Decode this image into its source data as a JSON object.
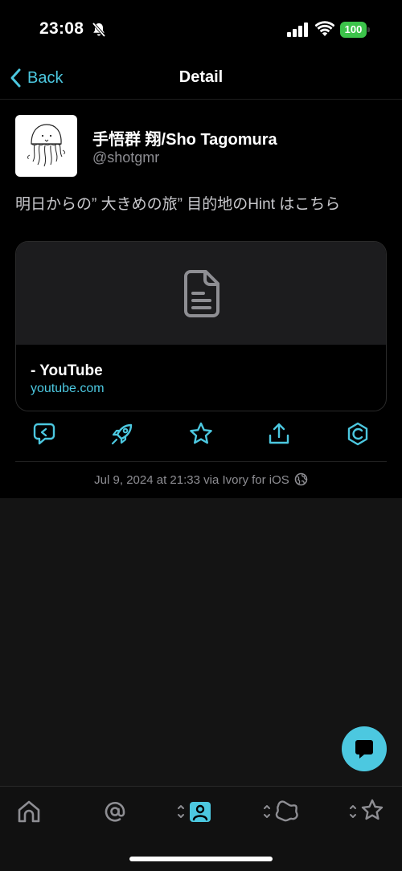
{
  "status_bar": {
    "time": "23:08",
    "battery": "100",
    "icons": [
      "bell-slash-icon",
      "signal-icon",
      "wifi-icon",
      "battery-icon"
    ]
  },
  "nav": {
    "back_label": "Back",
    "title": "Detail"
  },
  "post": {
    "display_name": "手悟群 翔/Sho Tagomura",
    "handle": "@shotgmr",
    "text": "明日からの” 大きめの旅” 目的地のHint はこちら",
    "link_card": {
      "title": "- YouTube",
      "domain": "youtube.com",
      "icon": "document-icon"
    },
    "meta": "Jul 9, 2024 at 21:33 via Ivory for iOS",
    "visibility_icon": "globe-icon",
    "actions": [
      "reply-icon",
      "boost-icon",
      "favorite-icon",
      "share-icon",
      "more-icon"
    ]
  },
  "compose_button": {
    "icon": "compose-bubble-icon"
  },
  "tab_bar": {
    "tabs": [
      "home-icon",
      "mentions-icon",
      "profile-icon",
      "lists-icon",
      "favorites-icon"
    ]
  },
  "colors": {
    "accent": "#4cc8e0",
    "background": "#000000",
    "secondary_text": "#8e8e93",
    "battery_green": "#3cc34a"
  }
}
